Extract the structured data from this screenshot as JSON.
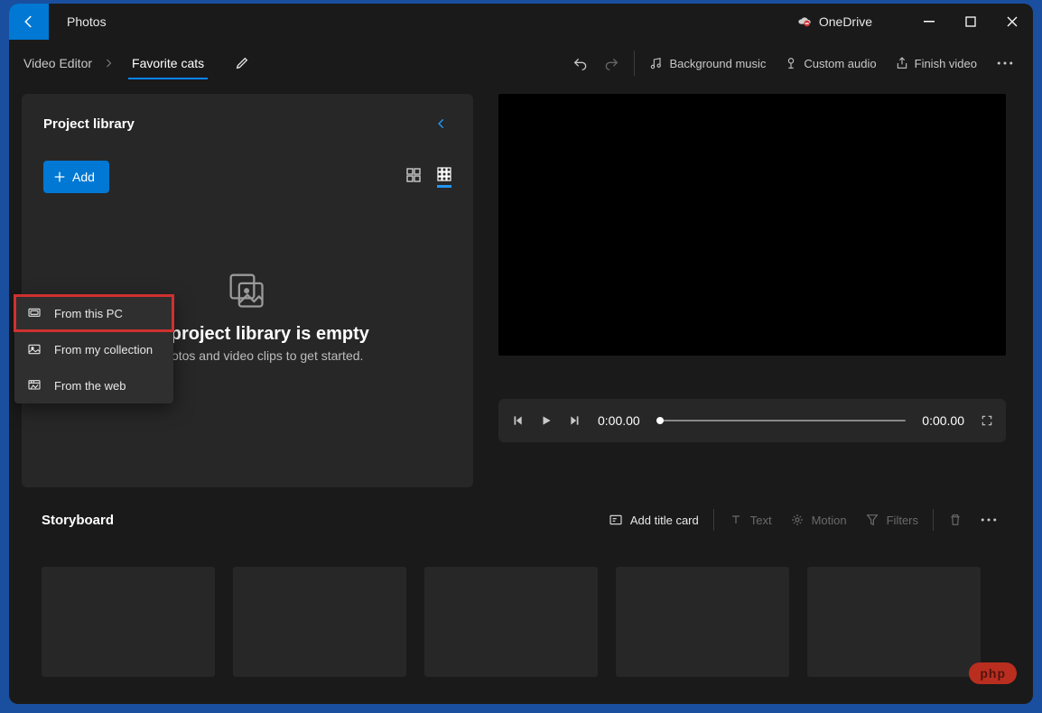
{
  "titlebar": {
    "app_name": "Photos",
    "onedrive_label": "OneDrive"
  },
  "breadcrumb": {
    "root": "Video Editor",
    "project_name": "Favorite cats"
  },
  "toolbar": {
    "undo": "Undo",
    "redo": "Redo",
    "bg_music": "Background music",
    "custom_audio": "Custom audio",
    "finish": "Finish video"
  },
  "library": {
    "title": "Project library",
    "add_label": "Add",
    "empty_title": "Your project library is empty",
    "empty_sub": "Add photos and video clips to get started."
  },
  "add_menu": {
    "items": [
      {
        "label": "From this PC"
      },
      {
        "label": "From my collection"
      },
      {
        "label": "From the web"
      }
    ]
  },
  "player": {
    "current_time": "0:00.00",
    "total_time": "0:00.00"
  },
  "storyboard": {
    "title": "Storyboard",
    "add_title_card": "Add title card",
    "text": "Text",
    "motion": "Motion",
    "filters": "Filters"
  },
  "watermark": "php"
}
